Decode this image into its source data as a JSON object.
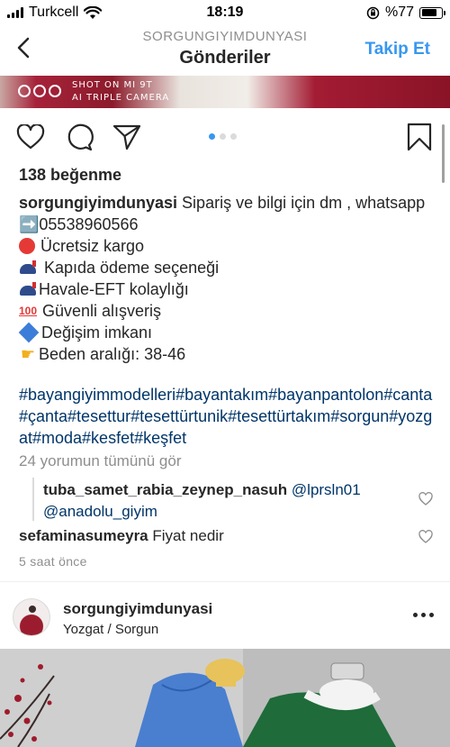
{
  "status_bar": {
    "carrier": "Turkcell",
    "time": "18:19",
    "battery": "%77",
    "battery_level": 0.77
  },
  "header": {
    "username": "SORGUNGIYIMDUNYASI",
    "title": "Gönderiler",
    "follow_label": "Takip Et"
  },
  "photo_strip": {
    "watermark_line1": "SHOT ON MI 9T",
    "watermark_line2": "AI TRIPLE CAMERA"
  },
  "post": {
    "likes": "138 beğenme",
    "caption": {
      "username": "sorgungiyimdunyasi",
      "text": "Sipariş ve bilgi için dm , whatsapp ➡️05538960566",
      "lines": [
        {
          "icon": "red-circle-icon",
          "text": "Ücretsiz kargo"
        },
        {
          "icon": "mailbox-icon",
          "text": "Kapıda ödeme seçeneği"
        },
        {
          "icon": "mailbox-icon",
          "text": "Havale-EFT kolaylığı"
        },
        {
          "icon": "hundred-points-icon",
          "text": "Güvenli alışveriş"
        },
        {
          "icon": "blue-diamond-icon",
          "text": "Değişim imkanı"
        },
        {
          "icon": "pointing-hand-icon",
          "text": "Beden aralığı: 38-46"
        }
      ]
    },
    "hashtags": "#bayangiyimmodelleri#bayantakım#bayanpantolon#canta#çanta#tesettur#tesettürtunik#tesettürtakım#sorgun#yozgat#moda#kesfet#keşfet",
    "view_all_comments": "24 yorumun tümünü gör",
    "comments": [
      {
        "user": "tuba_samet_rabia_zeynep_nasuh",
        "mentions": "@lprsln01 @anadolu_giyim",
        "text": ""
      },
      {
        "user": "sefaminasumeyra",
        "mentions": "",
        "text": "Fiyat nedir"
      }
    ],
    "time_ago": "5 saat önce"
  },
  "next_post": {
    "username": "sorgungiyimdunyasi",
    "location": "Yozgat / Sorgun"
  },
  "colors": {
    "link_blue": "#3897f0",
    "hashtag": "#003569",
    "muted": "#8e8e8e"
  }
}
